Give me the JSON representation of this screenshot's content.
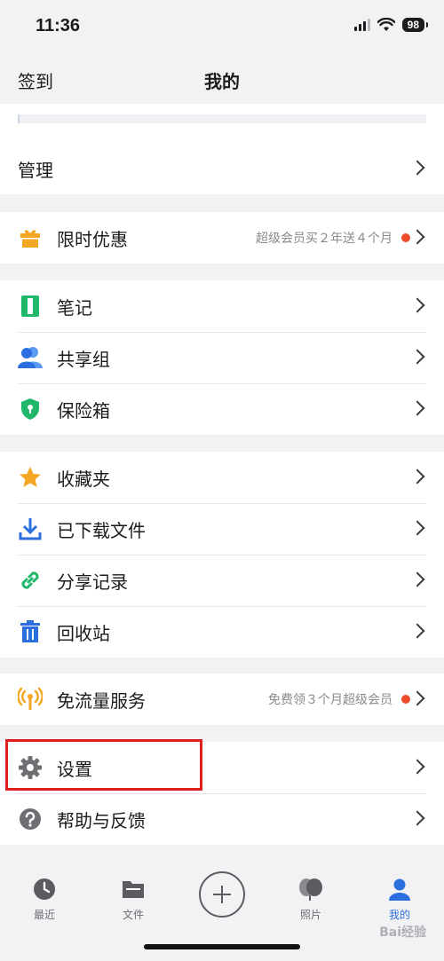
{
  "status": {
    "time": "11:36",
    "battery": "98"
  },
  "nav": {
    "left": "签到",
    "title": "我的"
  },
  "groups": {
    "manage": {
      "label": "管理"
    },
    "promo": {
      "label": "限时优惠",
      "hint": "超级会员买２年送４个月"
    },
    "tools": [
      {
        "label": "笔记"
      },
      {
        "label": "共享组"
      },
      {
        "label": "保险箱"
      }
    ],
    "files": [
      {
        "label": "收藏夹"
      },
      {
        "label": "已下载文件"
      },
      {
        "label": "分享记录"
      },
      {
        "label": "回收站"
      }
    ],
    "traffic": {
      "label": "免流量服务",
      "hint": "免费领３个月超级会员"
    },
    "settings": [
      {
        "label": "设置"
      },
      {
        "label": "帮助与反馈"
      }
    ]
  },
  "tabs": [
    {
      "label": "最近"
    },
    {
      "label": "文件"
    },
    {
      "label": "照片"
    },
    {
      "label": "我的"
    }
  ],
  "watermark": "Bai经验",
  "colors": {
    "accent": "#2b6fde",
    "badge": "#ee4d2d",
    "highlight": "#e01e1e"
  }
}
